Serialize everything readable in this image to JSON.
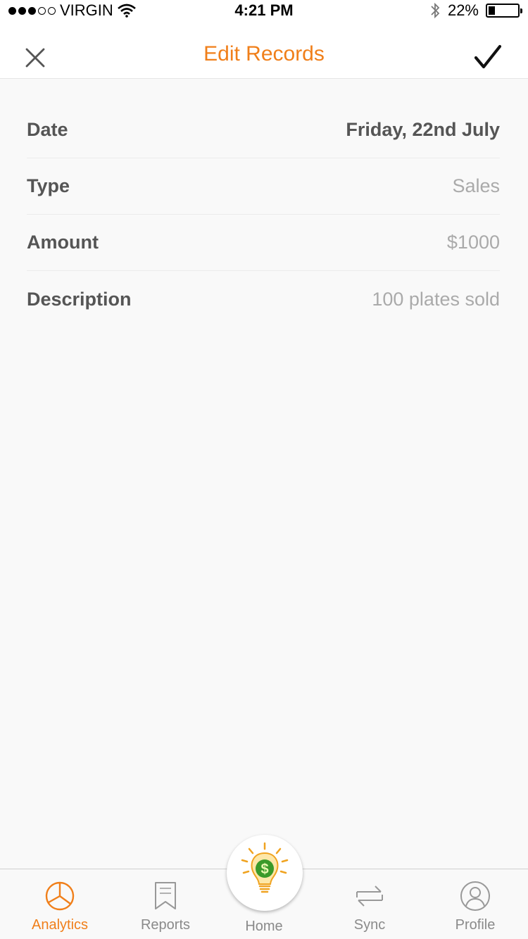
{
  "status_bar": {
    "carrier": "VIRGIN",
    "time": "4:21 PM",
    "battery": "22%",
    "battery_level": 0.22,
    "signal_bars_filled": 3,
    "signal_bars_total": 5
  },
  "header": {
    "title": "Edit Records",
    "close_icon": "close-icon",
    "confirm_icon": "checkmark-icon"
  },
  "form": {
    "rows": [
      {
        "label": "Date",
        "value": "Friday, 22nd July"
      },
      {
        "label": "Type",
        "value": "Sales"
      },
      {
        "label": "Amount",
        "value": "$1000"
      },
      {
        "label": "Description",
        "value": "100 plates sold"
      }
    ]
  },
  "tabs": {
    "analytics": "Analytics",
    "reports": "Reports",
    "home": "Home",
    "sync": "Sync",
    "profile": "Profile",
    "active": "analytics"
  },
  "colors": {
    "accent": "#f07f1a",
    "text": "#555555",
    "muted": "#aaaaaa",
    "background": "#f9f9f9"
  }
}
